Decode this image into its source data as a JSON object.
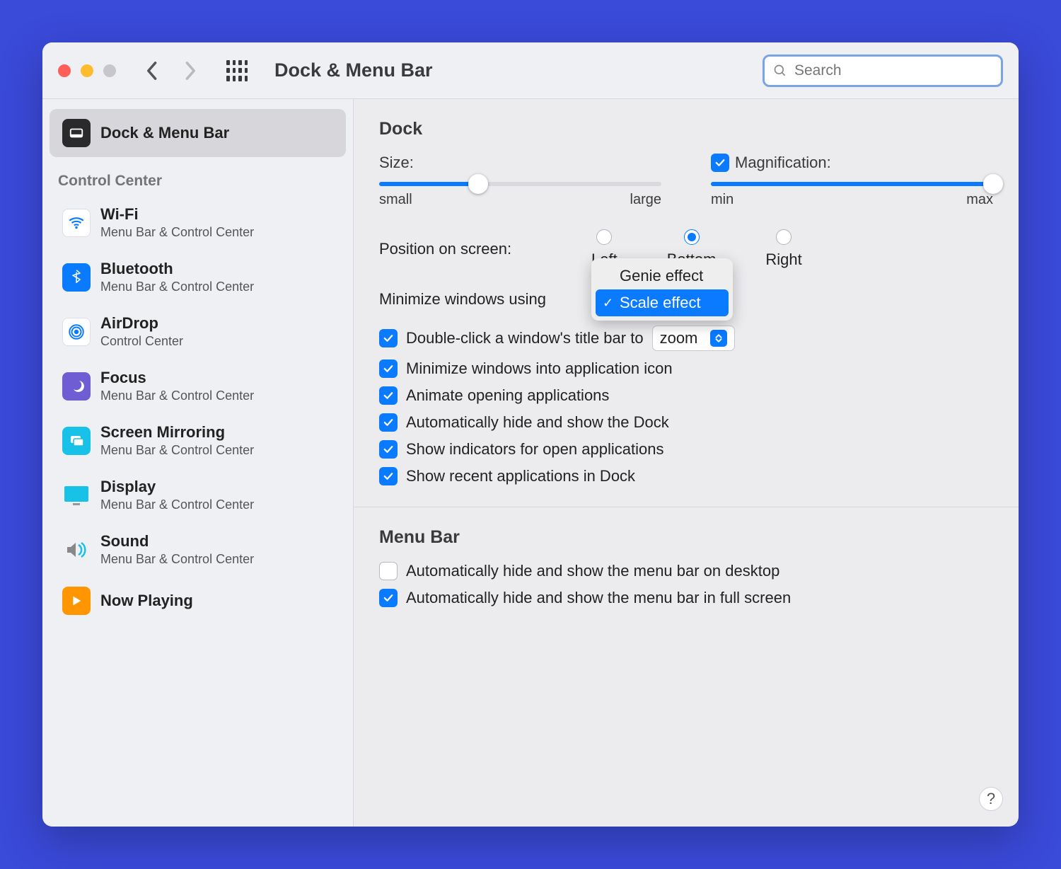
{
  "header": {
    "title": "Dock & Menu Bar",
    "search_placeholder": "Search"
  },
  "sidebar": {
    "selected": {
      "label": "Dock & Menu Bar"
    },
    "section_label": "Control Center",
    "items": [
      {
        "label": "Wi-Fi",
        "sub": "Menu Bar & Control Center",
        "icon": "wifi"
      },
      {
        "label": "Bluetooth",
        "sub": "Menu Bar & Control Center",
        "icon": "bluetooth"
      },
      {
        "label": "AirDrop",
        "sub": "Control Center",
        "icon": "airdrop"
      },
      {
        "label": "Focus",
        "sub": "Menu Bar & Control Center",
        "icon": "focus"
      },
      {
        "label": "Screen Mirroring",
        "sub": "Menu Bar & Control Center",
        "icon": "mirror"
      },
      {
        "label": "Display",
        "sub": "Menu Bar & Control Center",
        "icon": "display"
      },
      {
        "label": "Sound",
        "sub": "Menu Bar & Control Center",
        "icon": "sound"
      },
      {
        "label": "Now Playing",
        "sub": "",
        "icon": "nowplaying"
      }
    ]
  },
  "dock": {
    "heading": "Dock",
    "size": {
      "label": "Size:",
      "min_label": "small",
      "max_label": "large",
      "value_pct": 35
    },
    "magnification": {
      "label": "Magnification:",
      "checked": true,
      "min_label": "min",
      "max_label": "max",
      "value_pct": 100
    },
    "position": {
      "label": "Position on screen:",
      "left": "Left",
      "bottom": "Bottom",
      "right": "Right",
      "selected": "Bottom"
    },
    "minimize": {
      "label": "Minimize windows using",
      "options": [
        "Genie effect",
        "Scale effect"
      ],
      "selected": "Scale effect"
    },
    "doubleclick": {
      "checked": true,
      "label": "Double-click a window's title bar to",
      "value": "zoom"
    },
    "opts": [
      {
        "checked": true,
        "label": "Minimize windows into application icon"
      },
      {
        "checked": true,
        "label": "Animate opening applications"
      },
      {
        "checked": true,
        "label": "Automatically hide and show the Dock"
      },
      {
        "checked": true,
        "label": "Show indicators for open applications"
      },
      {
        "checked": true,
        "label": "Show recent applications in Dock"
      }
    ]
  },
  "menubar": {
    "heading": "Menu Bar",
    "opts": [
      {
        "checked": false,
        "label": "Automatically hide and show the menu bar on desktop"
      },
      {
        "checked": true,
        "label": "Automatically hide and show the menu bar in full screen"
      }
    ]
  },
  "help_label": "?"
}
